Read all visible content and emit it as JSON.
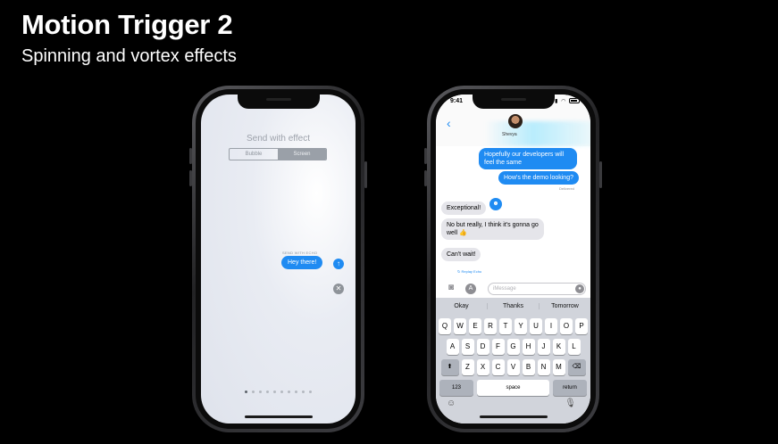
{
  "slide": {
    "title": "Motion Trigger 2",
    "subtitle": "Spinning and vortex effects"
  },
  "left_phone": {
    "effect_title": "Send with effect",
    "segments": [
      "Bubble",
      "Screen"
    ],
    "selected_segment": "Screen",
    "echo_label": "SEND WITH ECHO",
    "message": "Hey there!",
    "send_glyph": "↑",
    "cancel_glyph": "✕",
    "page_dots": 10,
    "active_dot": 0
  },
  "right_phone": {
    "status_time": "9:41",
    "contact_name": "Shevya",
    "messages": [
      {
        "side": "out",
        "text": "Hopefully our developers will feel the same"
      },
      {
        "side": "out",
        "text": "How's the demo looking?"
      },
      {
        "side": "in",
        "text": "Exceptional!"
      },
      {
        "side": "in",
        "text": "No but really, I think it's gonna go well 👍"
      },
      {
        "side": "in",
        "text": "Can't wait!"
      }
    ],
    "delivered_label": "Delivered",
    "replay_label": "↻ Replay Echo",
    "input_placeholder": "iMessage",
    "suggestions": [
      "Okay",
      "Thanks",
      "Tomorrow"
    ],
    "keyboard": {
      "row1": [
        "Q",
        "W",
        "E",
        "R",
        "T",
        "Y",
        "U",
        "I",
        "O",
        "P"
      ],
      "row2": [
        "A",
        "S",
        "D",
        "F",
        "G",
        "H",
        "J",
        "K",
        "L"
      ],
      "row3": [
        "Z",
        "X",
        "C",
        "V",
        "B",
        "N",
        "M"
      ],
      "shift": "⬆",
      "delete": "⌫",
      "numbers": "123",
      "space": "space",
      "return": "return"
    }
  }
}
